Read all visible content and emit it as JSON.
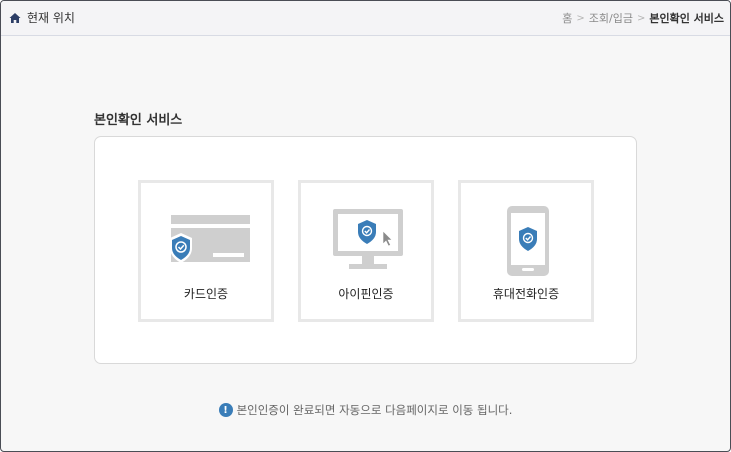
{
  "header": {
    "location_label": "현재 위치",
    "breadcrumb": {
      "home": "홈",
      "parent": "조회/입금",
      "current": "본인확인 서비스",
      "separator": ">"
    }
  },
  "main": {
    "section_title": "본인확인 서비스",
    "options": [
      {
        "label": "카드인증",
        "icon": "credit-card-shield-icon"
      },
      {
        "label": "아이핀인증",
        "icon": "monitor-shield-icon"
      },
      {
        "label": "휴대전화인증",
        "icon": "mobile-phone-shield-icon"
      }
    ],
    "notice_icon_glyph": "!",
    "notice_text": "본인인증이 완료되면 자동으로 다음페이지로 이동 됩니다."
  },
  "colors": {
    "shield": "#3a7db8",
    "device": "#cfcfcf",
    "accent": "#4a4d55"
  }
}
